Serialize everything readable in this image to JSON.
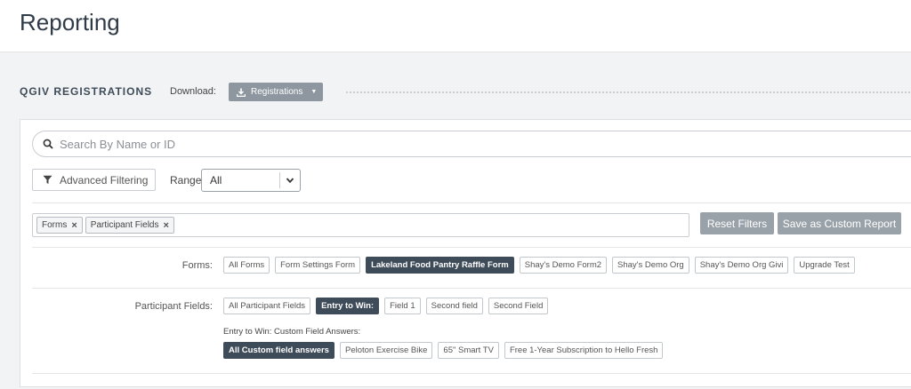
{
  "header": {
    "title": "Reporting"
  },
  "section": {
    "title": "QGIV REGISTRATIONS",
    "download_label": "Download:",
    "download_button": "Registrations"
  },
  "search": {
    "placeholder": "Search By Name or ID",
    "value": ""
  },
  "filters": {
    "advanced_label": "Advanced Filtering",
    "range_label": "Range",
    "range_value": "All",
    "tags": [
      "Forms",
      "Participant Fields"
    ],
    "reset_label": "Reset Filters",
    "save_label": "Save as Custom Report"
  },
  "forms": {
    "label": "Forms:",
    "options": [
      "All Forms",
      "Form Settings Form",
      "Lakeland Food Pantry Raffle Form",
      "Shay's Demo Form2",
      "Shay's Demo Org",
      "Shay's Demo Org Givi",
      "Upgrade Test"
    ],
    "selected": "Lakeland Food Pantry Raffle Form"
  },
  "participant_fields": {
    "label": "Participant Fields:",
    "options": [
      "All Participant Fields",
      "Entry to Win:",
      "Field 1",
      "Second field",
      "Second Field"
    ],
    "selected": "Entry to Win:",
    "custom_answers_label": "Entry to Win: Custom Field Answers:",
    "custom_answers": [
      "All Custom field answers",
      "Peloton Exercise Bike",
      "65\" Smart TV",
      "Free 1-Year Subscription to Hello Fresh"
    ],
    "custom_selected": "All Custom field answers"
  }
}
